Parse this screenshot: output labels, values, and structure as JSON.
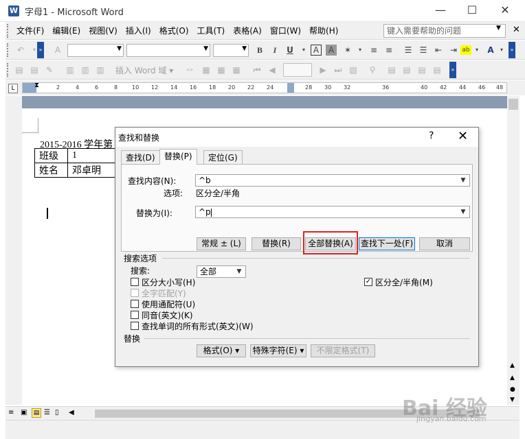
{
  "window": {
    "title": "字母1 - Microsoft Word",
    "icon_glyph": "W",
    "minimize_glyph": "—",
    "maximize_glyph": "☐",
    "close_glyph": "✕"
  },
  "menu": {
    "items": [
      "文件(F)",
      "编辑(E)",
      "视图(V)",
      "插入(I)",
      "格式(O)",
      "工具(T)",
      "表格(A)",
      "窗口(W)",
      "帮助(H)"
    ],
    "help_placeholder": "键入需要帮助的问题",
    "close_glyph": "✕"
  },
  "toolbar": {
    "insert_word_field": "插入 Word 域 ▾",
    "bold": "B",
    "italic": "I",
    "underline": "U",
    "char_border": "A",
    "char_shading": "A",
    "font_color": "A"
  },
  "ruler": {
    "ticks": [
      "2",
      "4",
      "6",
      "8",
      "10",
      "12",
      "14",
      "16",
      "18",
      "20",
      "22",
      "24",
      "28",
      "30",
      "32",
      "36",
      "40",
      "42",
      "44",
      "46",
      "48"
    ]
  },
  "document": {
    "heading": "2015-2016 学年第",
    "table": [
      [
        "班级",
        "1"
      ],
      [
        "姓名",
        "邓卓明"
      ]
    ]
  },
  "dialog": {
    "title": "查找和替换",
    "help_glyph": "?",
    "close_glyph": "✕",
    "tabs": {
      "find": "查找(D)",
      "replace": "替换(P)",
      "goto": "定位(G)"
    },
    "find_label": "查找内容(N):",
    "find_value": "^b",
    "options_label": "选项:",
    "options_value": "区分全/半角",
    "replace_label": "替换为(I):",
    "replace_value": "^p",
    "buttons": {
      "more": "常规 ± (L)",
      "replace": "替换(R)",
      "replace_all": "全部替换(A)",
      "find_next": "查找下一处(F)",
      "cancel": "取消"
    },
    "search_options_label": "搜索选项",
    "search_label": "搜索:",
    "search_value": "全部",
    "checkboxes": {
      "match_case": "区分大小写(H)",
      "whole_word": "全字匹配(Y)",
      "wildcards": "使用通配符(U)",
      "sounds_like": "同音(英文)(K)",
      "all_forms": "查找单词的所有形式(英文)(W)",
      "full_half_width": "区分全/半角(M)"
    },
    "replace_section_label": "替换",
    "format_button": "格式(O) ▾",
    "special_button": "特殊字符(E) ▾",
    "no_format_button": "不限定格式(T)"
  },
  "watermark": {
    "logo": "Bai 经验",
    "url": "jingyan.baidu.com"
  }
}
